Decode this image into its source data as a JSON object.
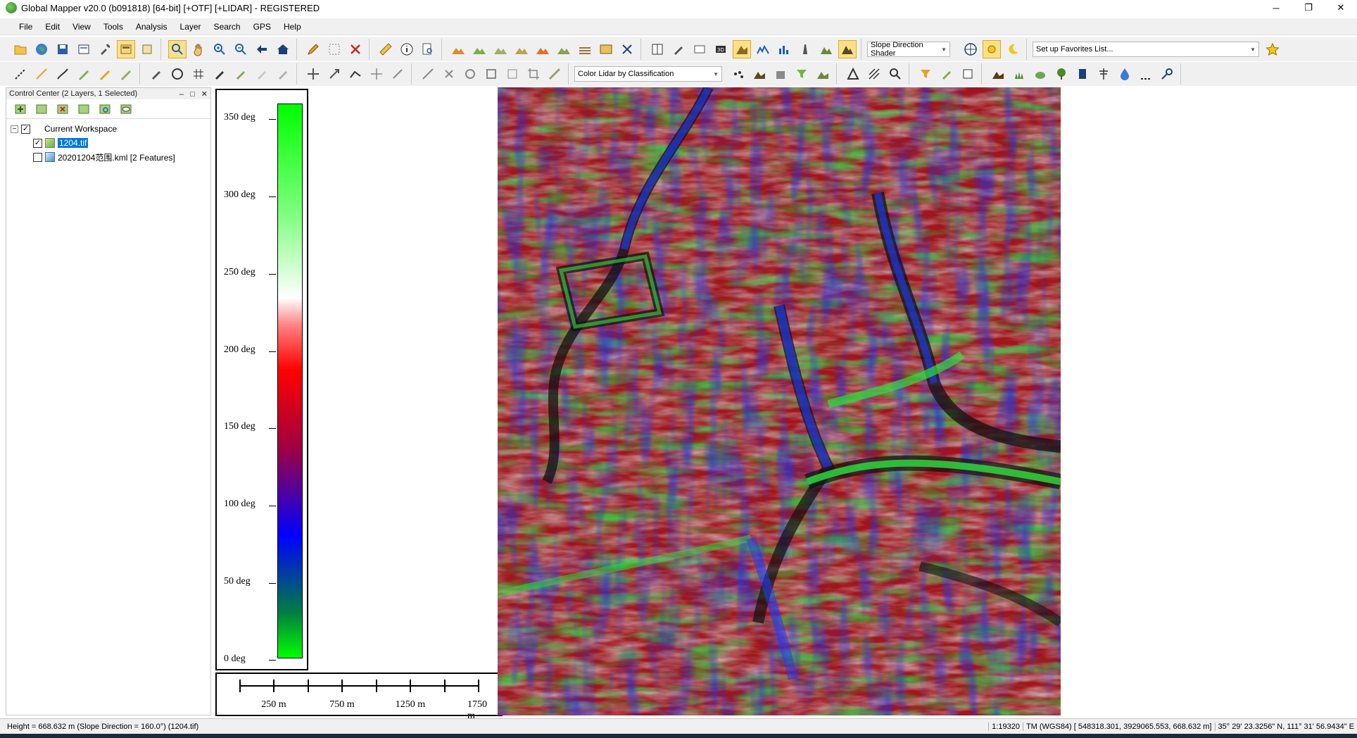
{
  "window": {
    "title": "Global Mapper v20.0 (b091818) [64-bit] [+OTF] [+LIDAR] - REGISTERED",
    "minimize": "─",
    "restore": "❐",
    "close": "✕"
  },
  "menu": [
    "File",
    "Edit",
    "View",
    "Tools",
    "Analysis",
    "Layer",
    "Search",
    "GPS",
    "Help"
  ],
  "toolbar": {
    "shader_select": "Slope Direction Shader",
    "favorites_select": "Set up Favorites List...",
    "lidar_select": "Color Lidar by Classification"
  },
  "control_center": {
    "title": "Control Center (2 Layers, 1 Selected)",
    "workspace_label": "Current Workspace",
    "layers": [
      {
        "name": "1204.tif",
        "checked": true,
        "selected": true
      },
      {
        "name": "20201204范围.kml [2 Features]",
        "checked": false,
        "selected": false
      }
    ]
  },
  "legend": {
    "labels": [
      "350 deg",
      "300 deg",
      "250 deg",
      "200 deg",
      "150 deg",
      "100 deg",
      "50 deg",
      "0 deg"
    ],
    "colors": {
      "green": "#00ff00",
      "white": "#ffffff",
      "red": "#ff0000",
      "purple": "#5000a0",
      "blue": "#0000ff"
    }
  },
  "scale_bar": {
    "labels": [
      "250 m",
      "750 m",
      "1250 m",
      "1750 m"
    ]
  },
  "status": {
    "left": "Height = 668.632 m (Slope Direction = 160.0°) (1204.tif)",
    "scale": "1:19320",
    "projection": "TM (WGS84) [ 548318.301, 3929065.553, 668.632 m]",
    "latlon": "35° 29' 23.3256\" N, 111° 31' 56.9434\" E"
  }
}
